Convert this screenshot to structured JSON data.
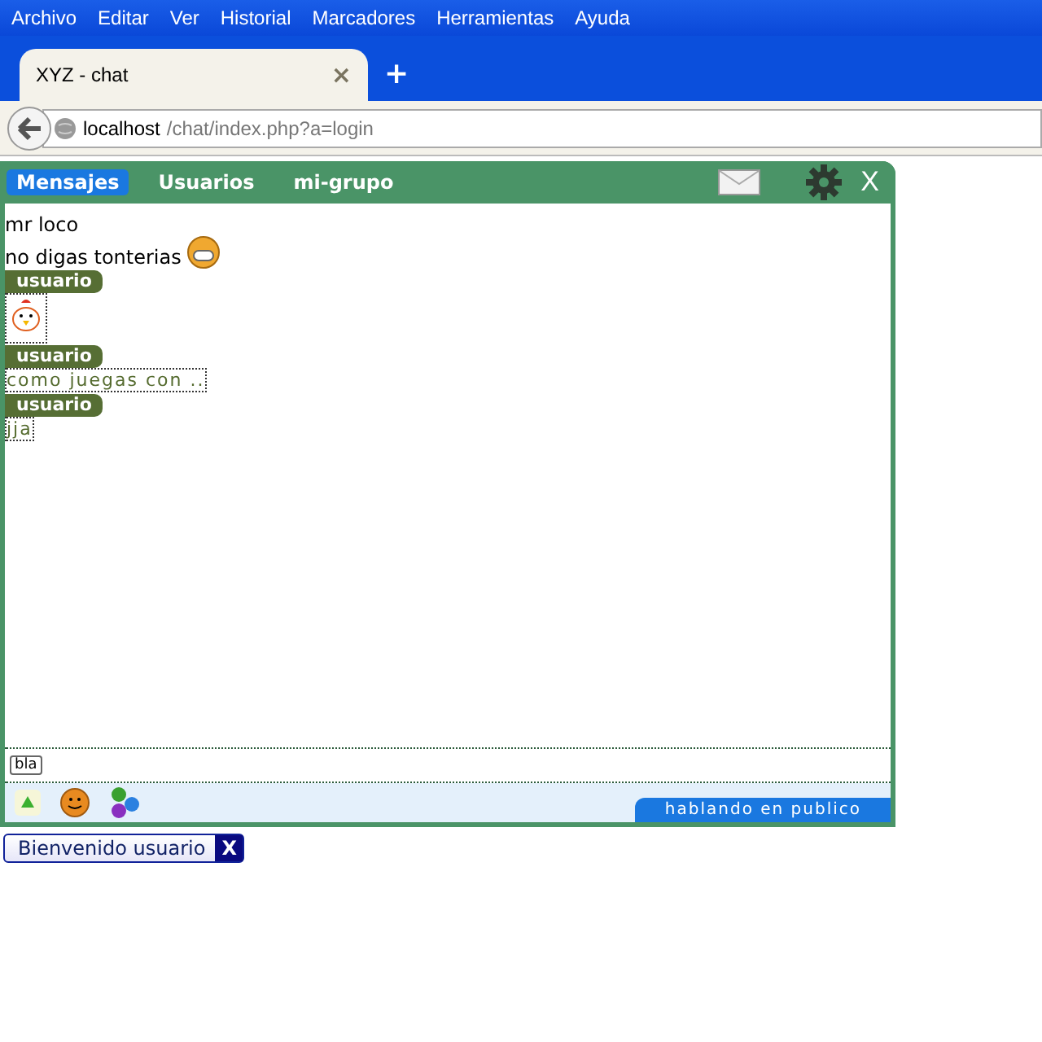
{
  "menu": [
    "Archivo",
    "Editar",
    "Ver",
    "Historial",
    "Marcadores",
    "Herramientas",
    "Ayuda"
  ],
  "browser_tab": {
    "title": "XYZ - chat",
    "close": "×",
    "new_tab": "+"
  },
  "address": {
    "host": "localhost",
    "path": "/chat/index.php?a=login"
  },
  "chat": {
    "tabs": [
      {
        "label": "Mensajes",
        "selected": true
      },
      {
        "label": "Usuarios",
        "selected": false
      },
      {
        "label": "mi-grupo",
        "selected": false
      }
    ],
    "close": "X",
    "messages": [
      {
        "kind": "text",
        "text": "mr loco"
      },
      {
        "kind": "text",
        "text": "no digas tonterias",
        "emoticon": true
      },
      {
        "kind": "author",
        "text": "usuario"
      },
      {
        "kind": "sticker"
      },
      {
        "kind": "author",
        "text": "usuario"
      },
      {
        "kind": "boxed",
        "text": "como juegas con .."
      },
      {
        "kind": "author",
        "text": "usuario"
      },
      {
        "kind": "boxed",
        "text": "jja"
      }
    ],
    "input_tag": "bla",
    "status": "hablando en publico"
  },
  "welcome": {
    "text": "Bienvenido usuario",
    "close": "X"
  }
}
